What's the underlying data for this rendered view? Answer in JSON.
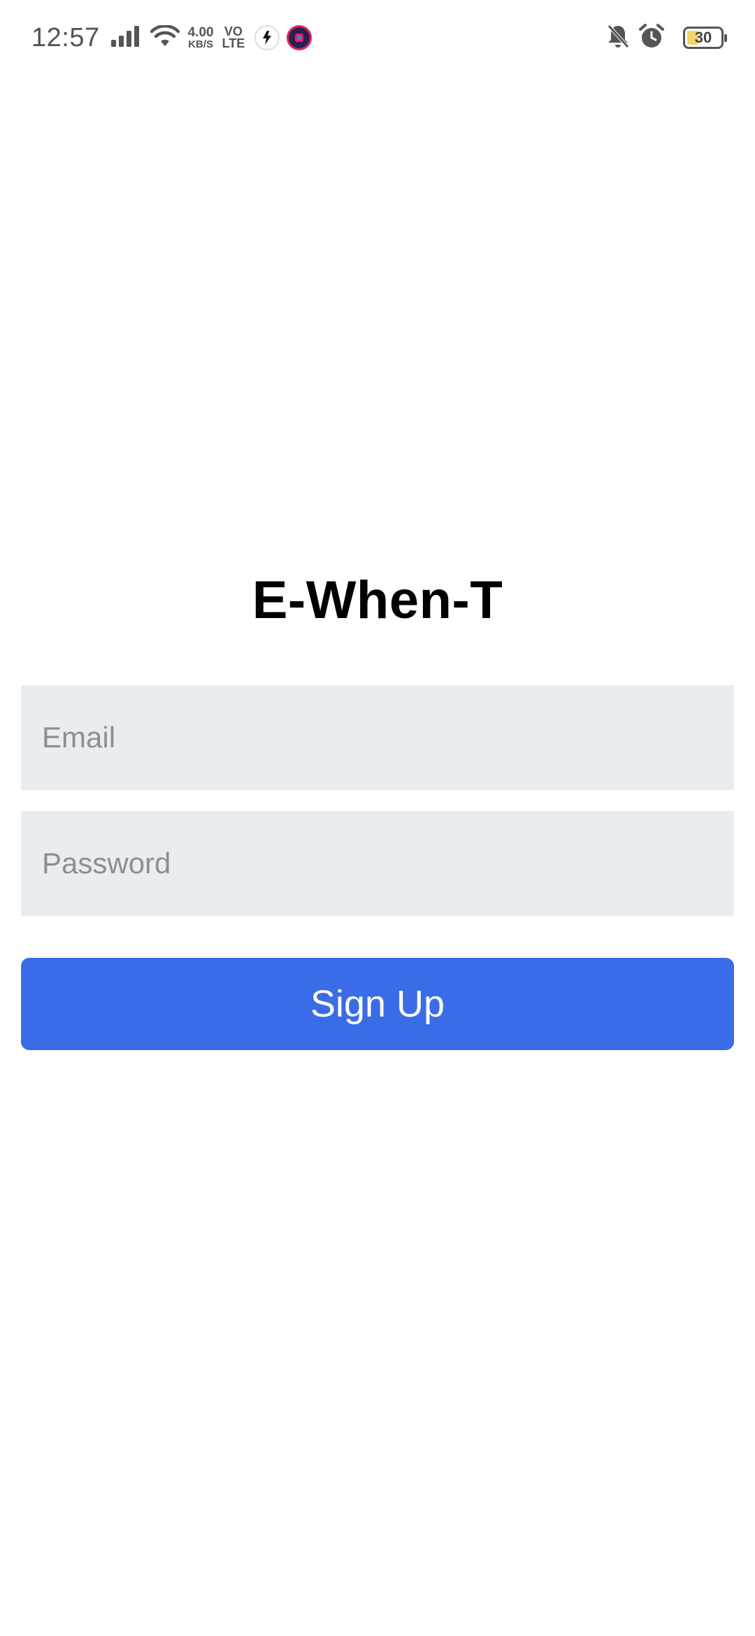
{
  "status_bar": {
    "time": "12:57",
    "network_speed_value": "4.00",
    "network_speed_unit": "KB/S",
    "volte_top": "VO",
    "volte_bottom": "LTE",
    "battery_level": "30",
    "battery_fraction": 0.3,
    "icons": [
      "signal-icon",
      "wifi-icon",
      "app-notification-icon",
      "app-notification-icon",
      "mute-bell-icon",
      "alarm-clock-icon",
      "battery-icon"
    ]
  },
  "app": {
    "title": "E-When-T"
  },
  "form": {
    "email_placeholder": "Email",
    "email_value": "",
    "password_placeholder": "Password",
    "password_value": "",
    "signup_label": "Sign Up"
  },
  "colors": {
    "accent": "#3b6ce7",
    "field_bg": "#eaedf0",
    "placeholder": "#8a8f96"
  }
}
